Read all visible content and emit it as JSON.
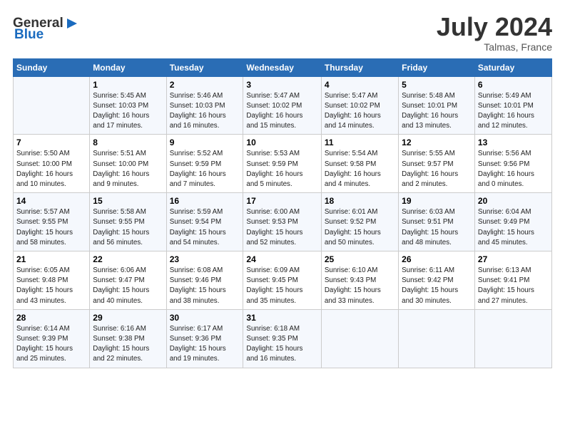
{
  "header": {
    "logo_general": "General",
    "logo_blue": "Blue",
    "month_year": "July 2024",
    "location": "Talmas, France"
  },
  "weekdays": [
    "Sunday",
    "Monday",
    "Tuesday",
    "Wednesday",
    "Thursday",
    "Friday",
    "Saturday"
  ],
  "weeks": [
    [
      {
        "day": "",
        "info": ""
      },
      {
        "day": "1",
        "info": "Sunrise: 5:45 AM\nSunset: 10:03 PM\nDaylight: 16 hours\nand 17 minutes."
      },
      {
        "day": "2",
        "info": "Sunrise: 5:46 AM\nSunset: 10:03 PM\nDaylight: 16 hours\nand 16 minutes."
      },
      {
        "day": "3",
        "info": "Sunrise: 5:47 AM\nSunset: 10:02 PM\nDaylight: 16 hours\nand 15 minutes."
      },
      {
        "day": "4",
        "info": "Sunrise: 5:47 AM\nSunset: 10:02 PM\nDaylight: 16 hours\nand 14 minutes."
      },
      {
        "day": "5",
        "info": "Sunrise: 5:48 AM\nSunset: 10:01 PM\nDaylight: 16 hours\nand 13 minutes."
      },
      {
        "day": "6",
        "info": "Sunrise: 5:49 AM\nSunset: 10:01 PM\nDaylight: 16 hours\nand 12 minutes."
      }
    ],
    [
      {
        "day": "7",
        "info": "Sunrise: 5:50 AM\nSunset: 10:00 PM\nDaylight: 16 hours\nand 10 minutes."
      },
      {
        "day": "8",
        "info": "Sunrise: 5:51 AM\nSunset: 10:00 PM\nDaylight: 16 hours\nand 9 minutes."
      },
      {
        "day": "9",
        "info": "Sunrise: 5:52 AM\nSunset: 9:59 PM\nDaylight: 16 hours\nand 7 minutes."
      },
      {
        "day": "10",
        "info": "Sunrise: 5:53 AM\nSunset: 9:59 PM\nDaylight: 16 hours\nand 5 minutes."
      },
      {
        "day": "11",
        "info": "Sunrise: 5:54 AM\nSunset: 9:58 PM\nDaylight: 16 hours\nand 4 minutes."
      },
      {
        "day": "12",
        "info": "Sunrise: 5:55 AM\nSunset: 9:57 PM\nDaylight: 16 hours\nand 2 minutes."
      },
      {
        "day": "13",
        "info": "Sunrise: 5:56 AM\nSunset: 9:56 PM\nDaylight: 16 hours\nand 0 minutes."
      }
    ],
    [
      {
        "day": "14",
        "info": "Sunrise: 5:57 AM\nSunset: 9:55 PM\nDaylight: 15 hours\nand 58 minutes."
      },
      {
        "day": "15",
        "info": "Sunrise: 5:58 AM\nSunset: 9:55 PM\nDaylight: 15 hours\nand 56 minutes."
      },
      {
        "day": "16",
        "info": "Sunrise: 5:59 AM\nSunset: 9:54 PM\nDaylight: 15 hours\nand 54 minutes."
      },
      {
        "day": "17",
        "info": "Sunrise: 6:00 AM\nSunset: 9:53 PM\nDaylight: 15 hours\nand 52 minutes."
      },
      {
        "day": "18",
        "info": "Sunrise: 6:01 AM\nSunset: 9:52 PM\nDaylight: 15 hours\nand 50 minutes."
      },
      {
        "day": "19",
        "info": "Sunrise: 6:03 AM\nSunset: 9:51 PM\nDaylight: 15 hours\nand 48 minutes."
      },
      {
        "day": "20",
        "info": "Sunrise: 6:04 AM\nSunset: 9:49 PM\nDaylight: 15 hours\nand 45 minutes."
      }
    ],
    [
      {
        "day": "21",
        "info": "Sunrise: 6:05 AM\nSunset: 9:48 PM\nDaylight: 15 hours\nand 43 minutes."
      },
      {
        "day": "22",
        "info": "Sunrise: 6:06 AM\nSunset: 9:47 PM\nDaylight: 15 hours\nand 40 minutes."
      },
      {
        "day": "23",
        "info": "Sunrise: 6:08 AM\nSunset: 9:46 PM\nDaylight: 15 hours\nand 38 minutes."
      },
      {
        "day": "24",
        "info": "Sunrise: 6:09 AM\nSunset: 9:45 PM\nDaylight: 15 hours\nand 35 minutes."
      },
      {
        "day": "25",
        "info": "Sunrise: 6:10 AM\nSunset: 9:43 PM\nDaylight: 15 hours\nand 33 minutes."
      },
      {
        "day": "26",
        "info": "Sunrise: 6:11 AM\nSunset: 9:42 PM\nDaylight: 15 hours\nand 30 minutes."
      },
      {
        "day": "27",
        "info": "Sunrise: 6:13 AM\nSunset: 9:41 PM\nDaylight: 15 hours\nand 27 minutes."
      }
    ],
    [
      {
        "day": "28",
        "info": "Sunrise: 6:14 AM\nSunset: 9:39 PM\nDaylight: 15 hours\nand 25 minutes."
      },
      {
        "day": "29",
        "info": "Sunrise: 6:16 AM\nSunset: 9:38 PM\nDaylight: 15 hours\nand 22 minutes."
      },
      {
        "day": "30",
        "info": "Sunrise: 6:17 AM\nSunset: 9:36 PM\nDaylight: 15 hours\nand 19 minutes."
      },
      {
        "day": "31",
        "info": "Sunrise: 6:18 AM\nSunset: 9:35 PM\nDaylight: 15 hours\nand 16 minutes."
      },
      {
        "day": "",
        "info": ""
      },
      {
        "day": "",
        "info": ""
      },
      {
        "day": "",
        "info": ""
      }
    ]
  ]
}
